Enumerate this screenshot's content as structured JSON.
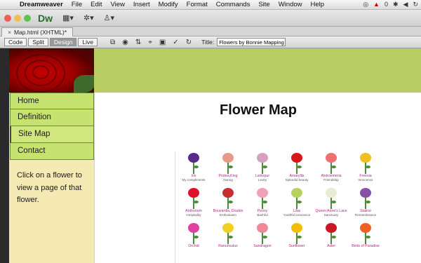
{
  "menubar": {
    "app_name": "Dreamweaver",
    "items": [
      "File",
      "Edit",
      "View",
      "Insert",
      "Modify",
      "Format",
      "Commands",
      "Site",
      "Window",
      "Help"
    ],
    "tray_badge": "0"
  },
  "appbar": {
    "logo": "Dw"
  },
  "document": {
    "tab_label": "Map.html (XHTML)*"
  },
  "doc_toolbar": {
    "views": [
      "Code",
      "Split",
      "Design",
      "Live"
    ],
    "active_view": "Design",
    "title_label": "Title:",
    "title_value": "Flowers by Bonnie Mapping Pa"
  },
  "page": {
    "heading": "Flower Map",
    "nav": [
      "Home",
      "Definition",
      "Site Map",
      "Contact"
    ],
    "active_nav": "Site Map",
    "sidebar_text": "Click on a flower to view a page of that flower."
  },
  "flowers": [
    {
      "name": "Iris",
      "meaning": "My compliments",
      "color": "#5a2a8a"
    },
    {
      "name": "Protea,King",
      "meaning": "Daring",
      "color": "#e89a8a"
    },
    {
      "name": "Larkspur",
      "meaning": "Levity",
      "color": "#d8a0c0"
    },
    {
      "name": "Amaryllis",
      "meaning": "Splendid beauty",
      "color": "#d81818"
    },
    {
      "name": "Alstroemeria",
      "meaning": "Friendship",
      "color": "#f07070"
    },
    {
      "name": "Freesia",
      "meaning": "Innocence",
      "color": "#f0c020"
    },
    {
      "name": "Anthurium",
      "meaning": "Hospitality",
      "color": "#e0102a"
    },
    {
      "name": "Bouvardia, Double",
      "meaning": "Enthusiasm",
      "color": "#c83030"
    },
    {
      "name": "Peony",
      "meaning": "Bashful",
      "color": "#f0a0b8"
    },
    {
      "name": "Lilac",
      "meaning": "Youthful innocence",
      "color": "#b8d060"
    },
    {
      "name": "Queen Anne's Lace",
      "meaning": "Sanctuary",
      "color": "#e8ecd0"
    },
    {
      "name": "Statice",
      "meaning": "Remembrance",
      "color": "#8850a8"
    },
    {
      "name": "Orchid",
      "meaning": "",
      "color": "#e040a0"
    },
    {
      "name": "Ranunculus",
      "meaning": "",
      "color": "#f0d020"
    },
    {
      "name": "Sandragon",
      "meaning": "",
      "color": "#f08898"
    },
    {
      "name": "Sunflower",
      "meaning": "",
      "color": "#f0c000"
    },
    {
      "name": "Aster",
      "meaning": "",
      "color": "#c81828"
    },
    {
      "name": "Birds of Paradise",
      "meaning": "",
      "color": "#f06020"
    }
  ],
  "colors": {
    "banner": "#b7cc63",
    "nav_bg": "#c6e36f",
    "sidebar_bg": "#f5e9b4",
    "flower_name": "#c0208a",
    "traffic_lights": [
      "#ec5f58",
      "#f4be4f",
      "#5fc54a"
    ]
  },
  "icons": [
    "apple-icon",
    "layout-menu-icon",
    "gear-icon",
    "user-icon",
    "multiscreen-icon",
    "preview-icon",
    "refresh-icon",
    "file-management-icon",
    "inspect-icon",
    "visual-aids-icon",
    "check-page-icon"
  ]
}
